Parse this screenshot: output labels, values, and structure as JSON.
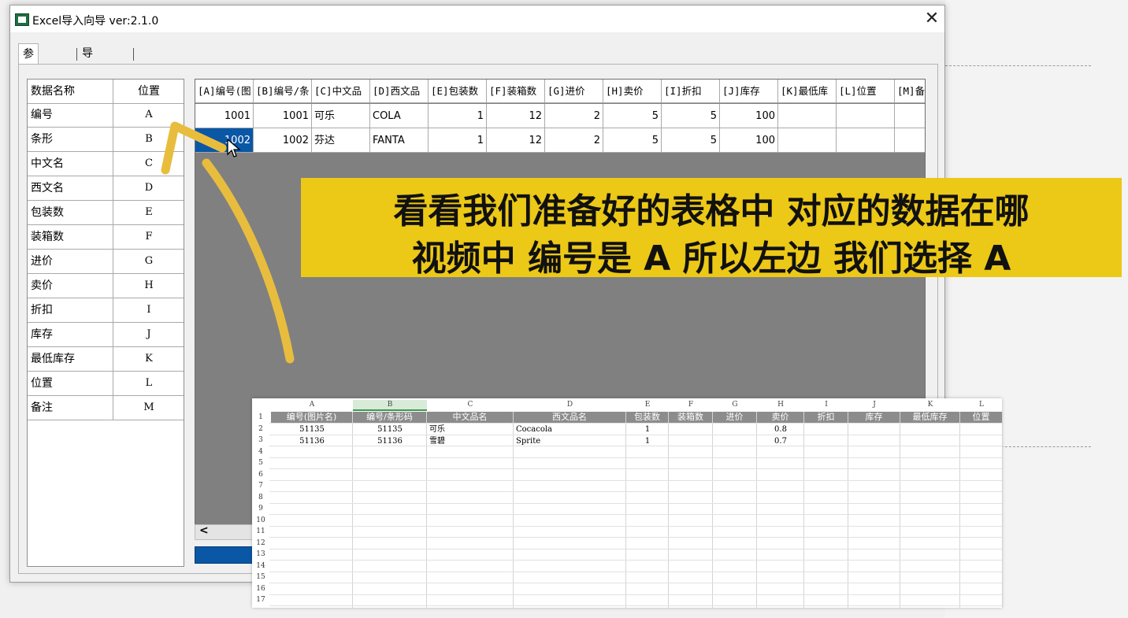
{
  "window": {
    "title": "Excel导入向导  ver:2.1.0",
    "close": "✕"
  },
  "tabs": [
    "参数设置",
    "导入预览"
  ],
  "params": {
    "headers": [
      "数据名称",
      "位置"
    ],
    "rows": [
      [
        "编号",
        "A"
      ],
      [
        "条形",
        "B"
      ],
      [
        "中文名",
        "C"
      ],
      [
        "西文名",
        "D"
      ],
      [
        "包装数",
        "E"
      ],
      [
        "装箱数",
        "F"
      ],
      [
        "进价",
        "G"
      ],
      [
        "卖价",
        "H"
      ],
      [
        "折扣",
        "I"
      ],
      [
        "库存",
        "J"
      ],
      [
        "最低库存",
        "K"
      ],
      [
        "位置",
        "L"
      ],
      [
        "备注",
        "M"
      ]
    ]
  },
  "grid": {
    "headers": [
      "[A]编号(图",
      "[B]编号/条",
      "[C]中文品",
      "[D]西文品",
      "[E]包装数",
      "[F]装箱数",
      "[G]进价",
      "[H]卖价",
      "[I]折扣",
      "[J]库存",
      "[K]最低库",
      "[L]位置",
      "[M]备"
    ],
    "rows": [
      [
        "1001",
        "1001",
        "可乐",
        "COLA",
        "1",
        "12",
        "2",
        "5",
        "5",
        "100",
        "",
        "",
        ""
      ],
      [
        "1002",
        "1002",
        "芬达",
        "FANTA",
        "1",
        "12",
        "2",
        "5",
        "5",
        "100",
        "",
        "",
        ""
      ]
    ],
    "scroll_left": "<"
  },
  "caption": {
    "line1": "看看我们准备好的表格中 对应的数据在哪",
    "line2": "视频中 编号是 A 所以左边 我们选择 A"
  },
  "sheet": {
    "col_letters": [
      "A",
      "B",
      "C",
      "D",
      "E",
      "F",
      "G",
      "H",
      "I",
      "J",
      "K",
      "L"
    ],
    "headers": [
      "编号(图片名)",
      "编号/条形码",
      "中文品名",
      "西文品名",
      "包装数",
      "装箱数",
      "进价",
      "卖价",
      "折扣",
      "库存",
      "最低库存",
      "位置"
    ],
    "rows": [
      [
        "51135",
        "51135",
        "可乐",
        "Cocacola",
        "1",
        "",
        "",
        "0.8",
        "",
        "",
        "",
        ""
      ],
      [
        "51136",
        "51136",
        "雪碧",
        "Sprite",
        "1",
        "",
        "",
        "0.7",
        "",
        "",
        "",
        ""
      ]
    ],
    "row_numbers": [
      "1",
      "2",
      "3",
      "4",
      "5",
      "6",
      "7",
      "8",
      "9",
      "10",
      "11",
      "12",
      "13",
      "14",
      "15",
      "16",
      "17"
    ]
  },
  "colors": {
    "selected": "#0a57a6",
    "caption_bg": "#ecc817",
    "arrow": "#e8bd3e"
  }
}
